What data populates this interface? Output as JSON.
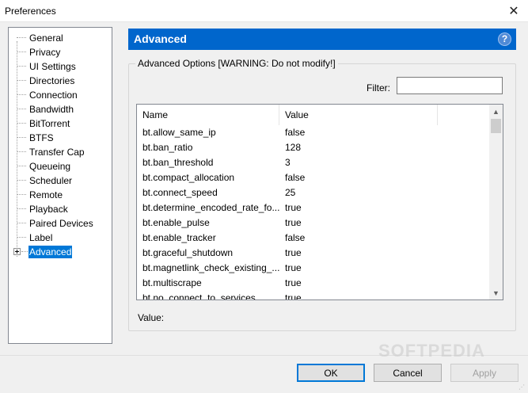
{
  "window": {
    "title": "Preferences"
  },
  "tree": {
    "items": [
      {
        "label": "General"
      },
      {
        "label": "Privacy"
      },
      {
        "label": "UI Settings"
      },
      {
        "label": "Directories"
      },
      {
        "label": "Connection"
      },
      {
        "label": "Bandwidth"
      },
      {
        "label": "BitTorrent"
      },
      {
        "label": "BTFS"
      },
      {
        "label": "Transfer Cap"
      },
      {
        "label": "Queueing"
      },
      {
        "label": "Scheduler"
      },
      {
        "label": "Remote"
      },
      {
        "label": "Playback"
      },
      {
        "label": "Paired Devices"
      },
      {
        "label": "Label"
      },
      {
        "label": "Advanced",
        "selected": true
      }
    ]
  },
  "panel": {
    "title": "Advanced",
    "help": "?",
    "group_label": "Advanced Options [WARNING: Do not modify!]",
    "filter_label": "Filter:",
    "filter_value": "",
    "columns": {
      "name": "Name",
      "value": "Value"
    },
    "rows": [
      {
        "name": "bt.allow_same_ip",
        "value": "false"
      },
      {
        "name": "bt.ban_ratio",
        "value": "128"
      },
      {
        "name": "bt.ban_threshold",
        "value": "3"
      },
      {
        "name": "bt.compact_allocation",
        "value": "false"
      },
      {
        "name": "bt.connect_speed",
        "value": "25"
      },
      {
        "name": "bt.determine_encoded_rate_fo...",
        "value": "true"
      },
      {
        "name": "bt.enable_pulse",
        "value": "true"
      },
      {
        "name": "bt.enable_tracker",
        "value": "false"
      },
      {
        "name": "bt.graceful_shutdown",
        "value": "true"
      },
      {
        "name": "bt.magnetlink_check_existing_...",
        "value": "true"
      },
      {
        "name": "bt.multiscrape",
        "value": "true"
      },
      {
        "name": "bt.no_connect_to_services",
        "value": "true"
      }
    ],
    "value_label": "Value:"
  },
  "buttons": {
    "ok": "OK",
    "cancel": "Cancel",
    "apply": "Apply"
  },
  "watermark": "SOFTPEDIA"
}
